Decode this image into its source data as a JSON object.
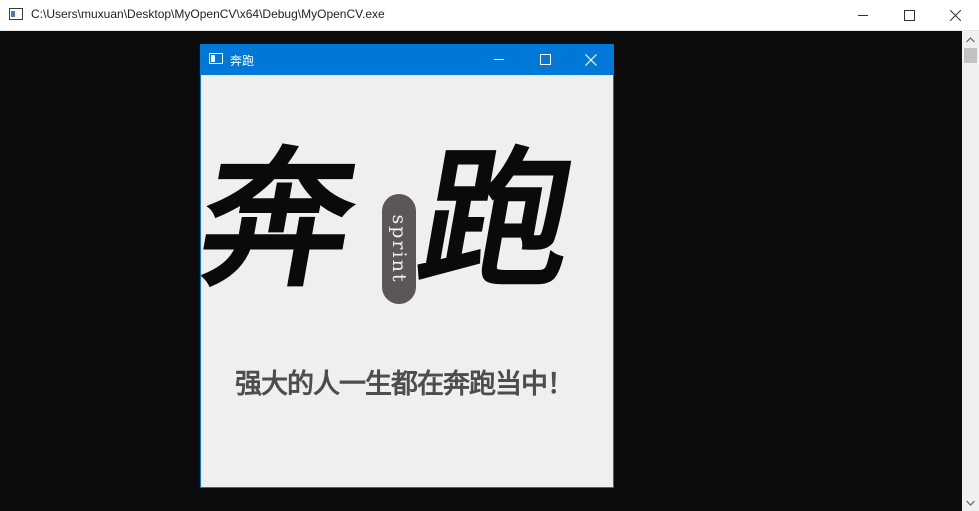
{
  "console_window": {
    "title": "C:\\Users\\muxuan\\Desktop\\MyOpenCV\\x64\\Debug\\MyOpenCV.exe",
    "buttons": {
      "minimize": "minimize-icon",
      "maximize": "maximize-icon",
      "close": "close-icon"
    },
    "background_color": "#0c0c0c"
  },
  "image_window": {
    "title": "奔跑",
    "accent_color": "#0078d7",
    "image": {
      "left_character": "奔",
      "right_character": "跑",
      "badge_text": "sprint",
      "slogan": "强大的人一生都在奔跑当中！"
    }
  }
}
